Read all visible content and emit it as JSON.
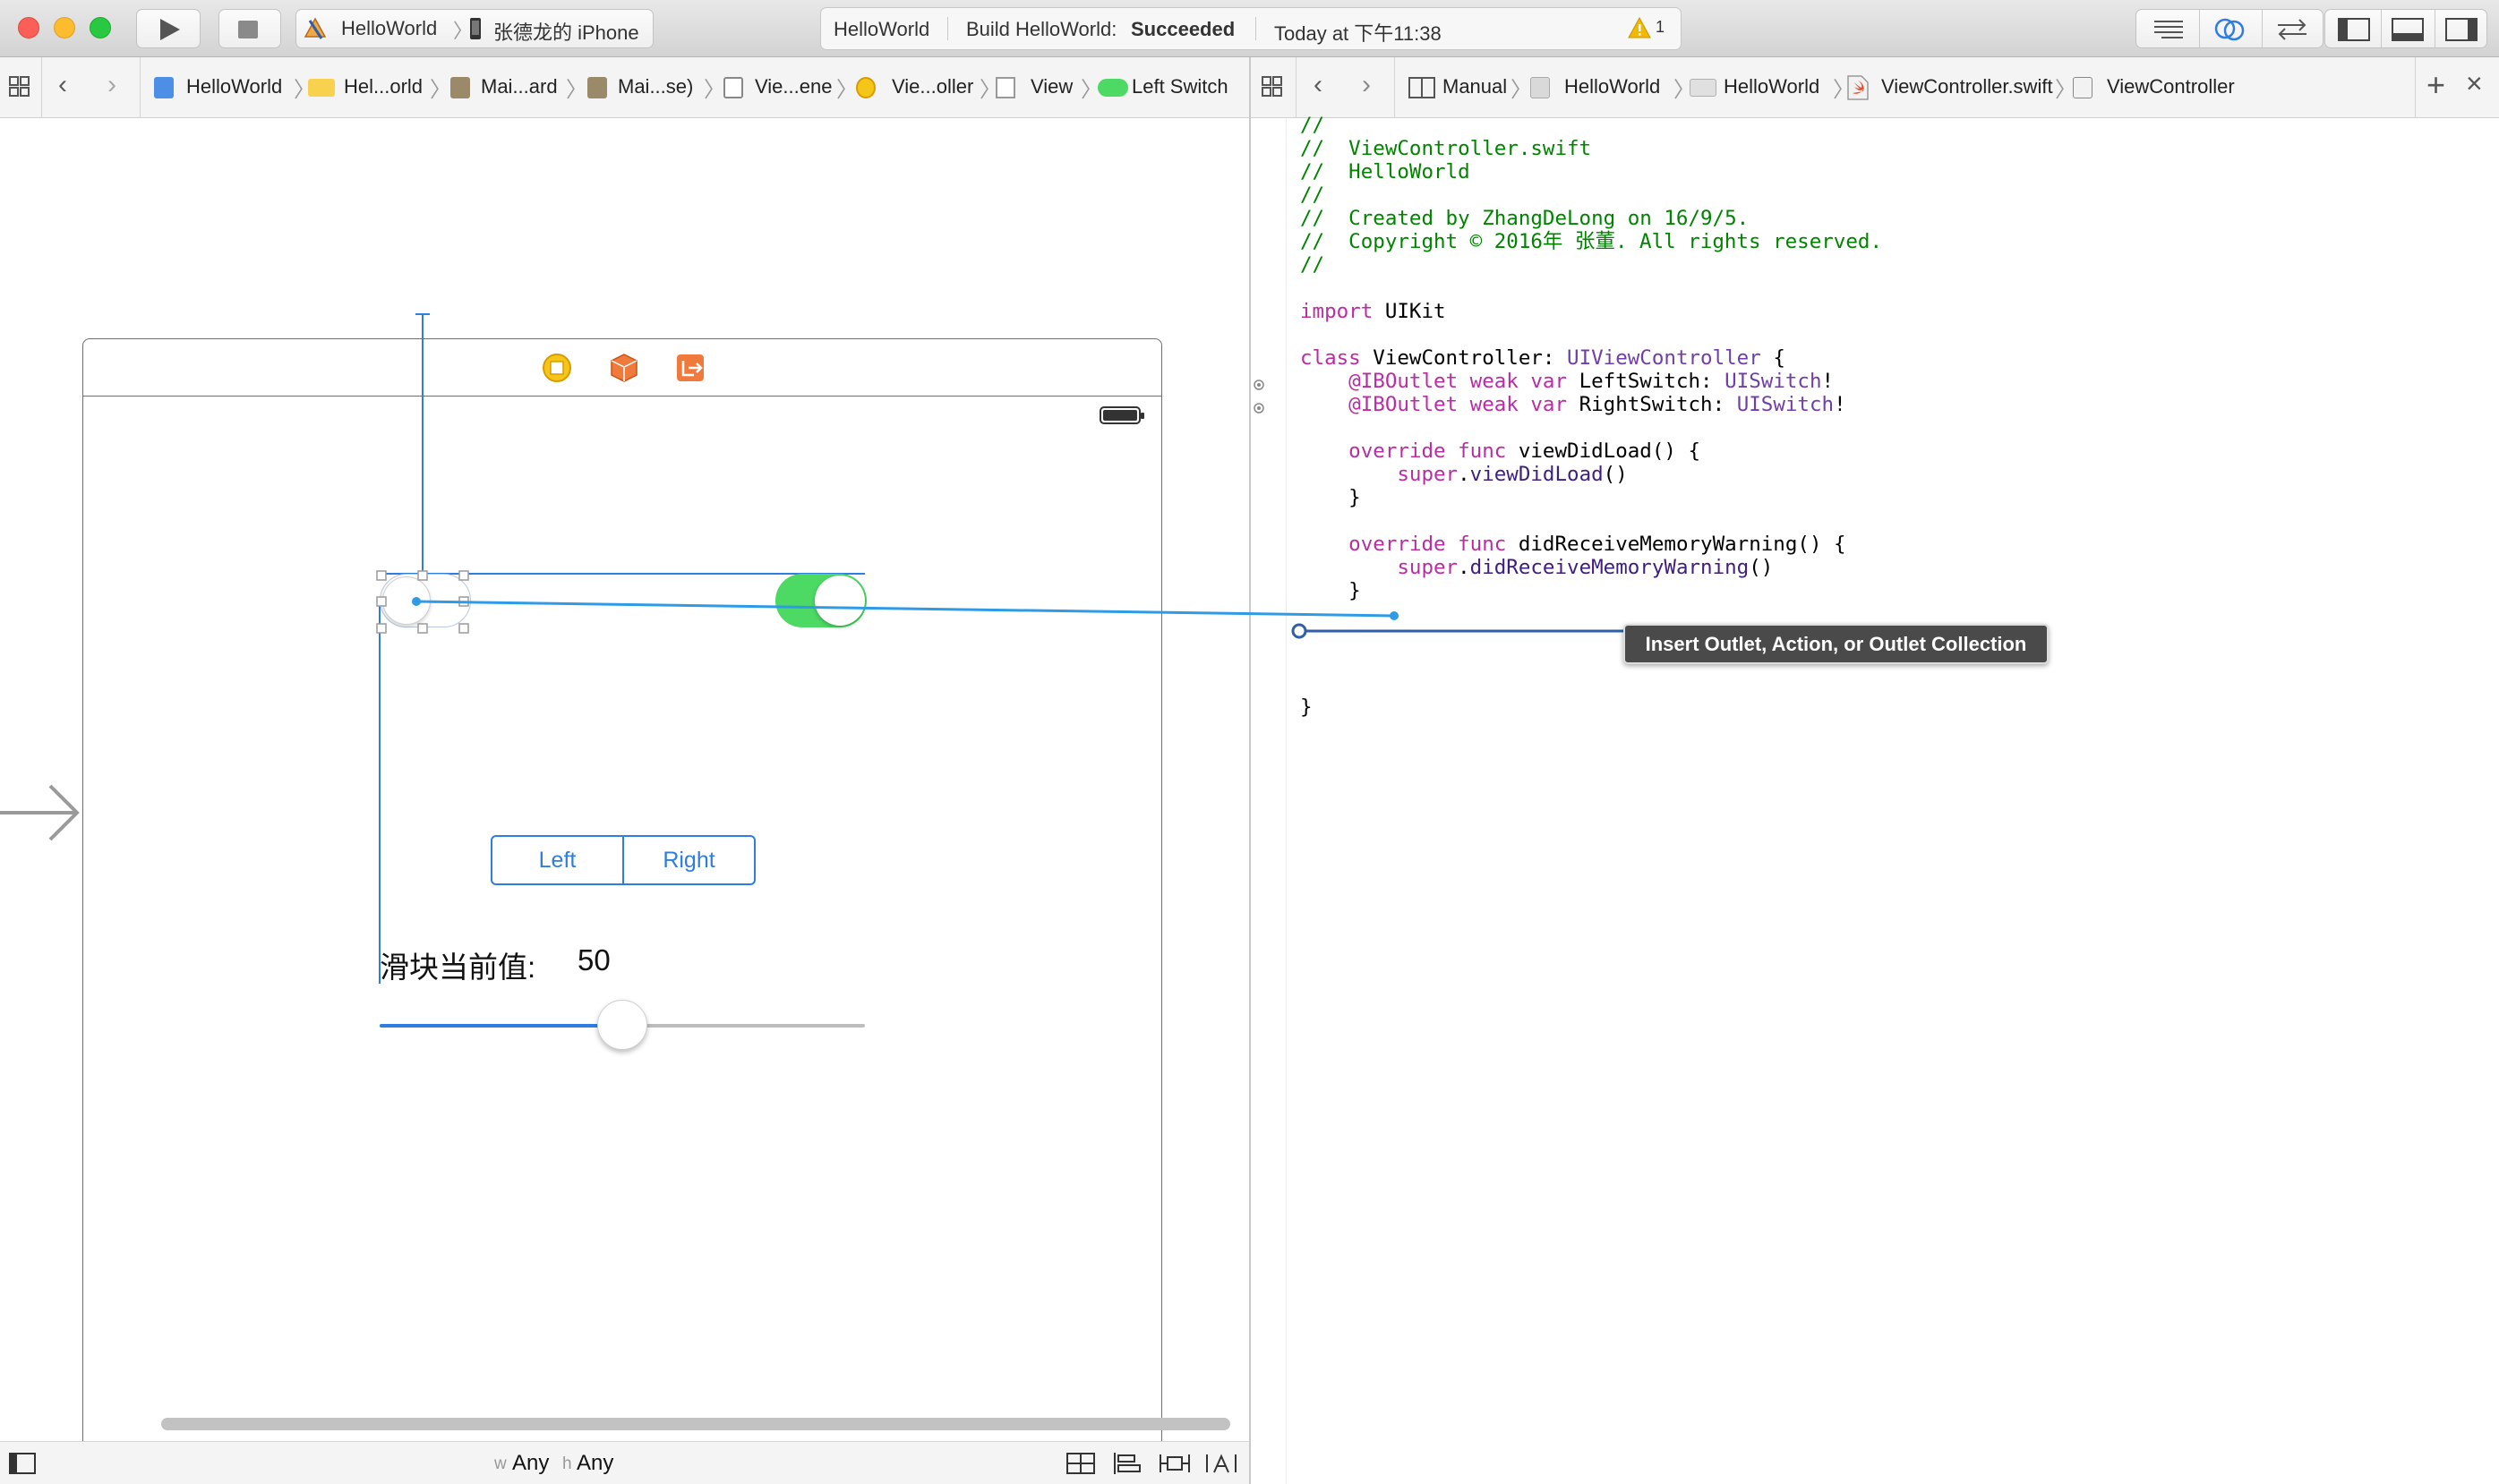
{
  "toolbar": {
    "scheme": "HelloWorld",
    "device": "张德龙的 iPhone",
    "status": {
      "project": "HelloWorld",
      "build_prefix": "Build HelloWorld:",
      "build_result": "Succeeded",
      "time": "Today at 下午11:38",
      "warning_count": "1"
    }
  },
  "left_jumpbar": {
    "items": [
      "HelloWorld",
      "Hel...orld",
      "Mai...ard",
      "Mai...se)",
      "Vie...ene",
      "Vie...oller",
      "View",
      "Left Switch"
    ]
  },
  "right_jumpbar": {
    "items": [
      "Manual",
      "HelloWorld",
      "HelloWorld",
      "ViewController.swift",
      "ViewController"
    ]
  },
  "canvas": {
    "segment_left": "Left",
    "segment_right": "Right",
    "slider_label": "滑块当前值:",
    "slider_value_text": "50",
    "slider_value": 0.5
  },
  "code": {
    "lines": [
      {
        "parts": [
          {
            "t": "//",
            "c": "cm"
          }
        ]
      },
      {
        "parts": [
          {
            "t": "//  ViewController.swift",
            "c": "cm"
          }
        ]
      },
      {
        "parts": [
          {
            "t": "//  HelloWorld",
            "c": "cm"
          }
        ]
      },
      {
        "parts": [
          {
            "t": "//",
            "c": "cm"
          }
        ]
      },
      {
        "parts": [
          {
            "t": "//  Created by ZhangDeLong on 16/9/5.",
            "c": "cm"
          }
        ]
      },
      {
        "parts": [
          {
            "t": "//  Copyright © 2016年 张董. All rights reserved.",
            "c": "cm"
          }
        ]
      },
      {
        "parts": [
          {
            "t": "//",
            "c": "cm"
          }
        ]
      },
      {
        "parts": []
      },
      {
        "parts": [
          {
            "t": "import",
            "c": "kw"
          },
          {
            "t": " UIKit",
            "c": ""
          }
        ]
      },
      {
        "parts": []
      },
      {
        "parts": [
          {
            "t": "class",
            "c": "kw"
          },
          {
            "t": " ViewController: ",
            "c": ""
          },
          {
            "t": "UIViewController",
            "c": "ty"
          },
          {
            "t": " {",
            "c": ""
          }
        ]
      },
      {
        "parts": [
          {
            "t": "    @IBOutlet",
            "c": "kw"
          },
          {
            "t": " ",
            "c": ""
          },
          {
            "t": "weak",
            "c": "kw"
          },
          {
            "t": " ",
            "c": ""
          },
          {
            "t": "var",
            "c": "kw"
          },
          {
            "t": " LeftSwitch: ",
            "c": ""
          },
          {
            "t": "UISwitch",
            "c": "ty"
          },
          {
            "t": "!",
            "c": ""
          }
        ]
      },
      {
        "parts": [
          {
            "t": "    @IBOutlet",
            "c": "kw"
          },
          {
            "t": " ",
            "c": ""
          },
          {
            "t": "weak",
            "c": "kw"
          },
          {
            "t": " ",
            "c": ""
          },
          {
            "t": "var",
            "c": "kw"
          },
          {
            "t": " RightSwitch: ",
            "c": ""
          },
          {
            "t": "UISwitch",
            "c": "ty"
          },
          {
            "t": "!",
            "c": ""
          }
        ]
      },
      {
        "parts": []
      },
      {
        "parts": [
          {
            "t": "    override",
            "c": "kw"
          },
          {
            "t": " ",
            "c": ""
          },
          {
            "t": "func",
            "c": "kw"
          },
          {
            "t": " viewDidLoad() {",
            "c": ""
          }
        ]
      },
      {
        "parts": [
          {
            "t": "        super",
            "c": "kw"
          },
          {
            "t": ".",
            "c": ""
          },
          {
            "t": "viewDidLoad",
            "c": "fn"
          },
          {
            "t": "()",
            "c": ""
          }
        ]
      },
      {
        "parts": [
          {
            "t": "    }",
            "c": ""
          }
        ]
      },
      {
        "parts": []
      },
      {
        "parts": [
          {
            "t": "    override",
            "c": "kw"
          },
          {
            "t": " ",
            "c": ""
          },
          {
            "t": "func",
            "c": "kw"
          },
          {
            "t": " didReceiveMemoryWarning() {",
            "c": ""
          }
        ]
      },
      {
        "parts": [
          {
            "t": "        super",
            "c": "kw"
          },
          {
            "t": ".",
            "c": ""
          },
          {
            "t": "didReceiveMemoryWarning",
            "c": "fn"
          },
          {
            "t": "()",
            "c": ""
          }
        ]
      },
      {
        "parts": [
          {
            "t": "    }",
            "c": ""
          }
        ]
      },
      {
        "parts": []
      },
      {
        "parts": []
      },
      {
        "parts": []
      },
      {
        "parts": []
      },
      {
        "parts": [
          {
            "t": "}",
            "c": ""
          }
        ]
      }
    ]
  },
  "tooltip": "Insert Outlet, Action, or Outlet Collection",
  "bottombar": {
    "w_prefix": "w",
    "w_value": "Any",
    "h_prefix": "h",
    "h_value": "Any"
  },
  "icons": {
    "scheme": "xcode-app-icon",
    "device": "iphone-icon",
    "warning": "warning-triangle-icon",
    "file": "swift-file-icon"
  },
  "colors": {
    "accent": "#2f7de0",
    "switch_on": "#4cd964",
    "warning": "#f5b800",
    "connection_line": "#2f9be6"
  }
}
